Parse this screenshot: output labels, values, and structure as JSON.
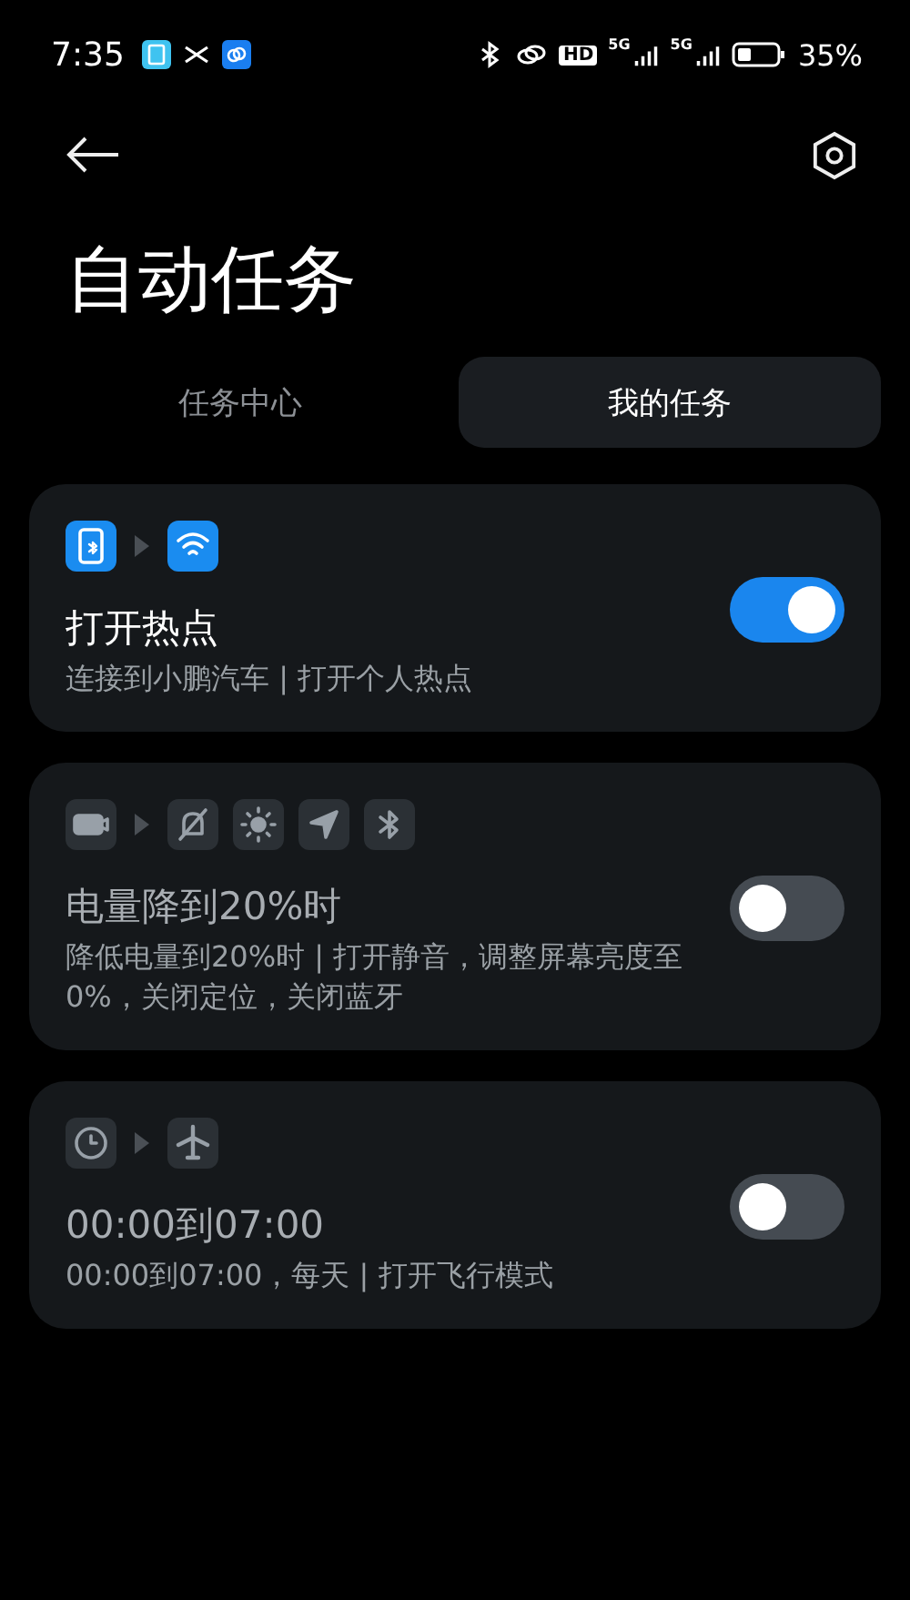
{
  "status_bar": {
    "time": "7:35",
    "network_labels": [
      "HD",
      "5G",
      "5G"
    ],
    "battery": "35%"
  },
  "header": {
    "title": "自动任务"
  },
  "tabs": [
    {
      "label": "任务中心",
      "selected": false
    },
    {
      "label": "我的任务",
      "selected": true
    }
  ],
  "tasks": [
    {
      "trigger": {
        "kind": "phone-bluetooth"
      },
      "actions": [
        {
          "kind": "wifi"
        }
      ],
      "title": "打开热点",
      "description": "连接到小鹏汽车 | 打开个人热点",
      "on": true
    },
    {
      "trigger": {
        "kind": "battery"
      },
      "actions": [
        {
          "kind": "bell-off"
        },
        {
          "kind": "sun"
        },
        {
          "kind": "location"
        },
        {
          "kind": "bluetooth"
        }
      ],
      "title": "电量降到20%时",
      "description": "降低电量到20%时 | 打开静音，调整屏幕亮度至0%，关闭定位，关闭蓝牙",
      "on": false
    },
    {
      "trigger": {
        "kind": "clock"
      },
      "actions": [
        {
          "kind": "airplane"
        }
      ],
      "title": "00:00到07:00",
      "description": "00:00到07:00，每天 | 打开飞行模式",
      "on": false
    }
  ]
}
